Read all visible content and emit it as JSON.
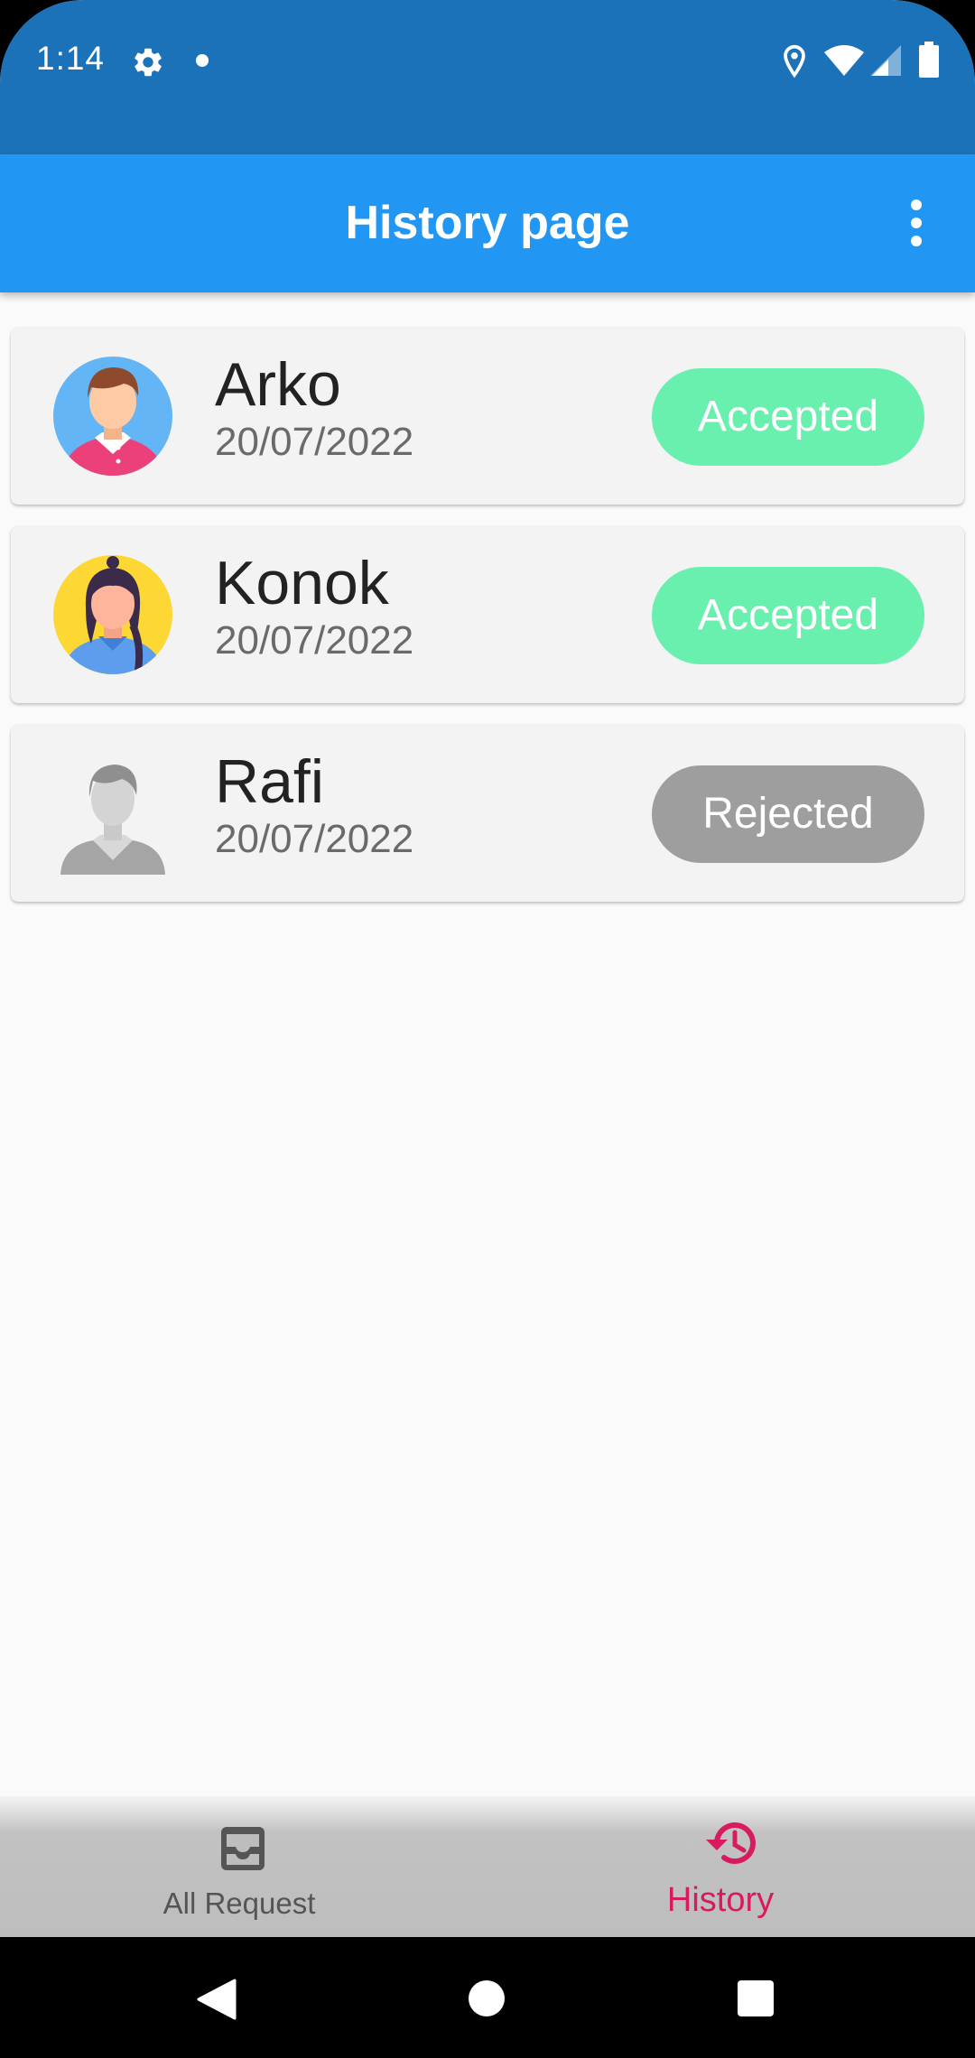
{
  "status_bar": {
    "time": "1:14",
    "icons": [
      "gear-icon",
      "dot-icon",
      "location-icon",
      "wifi-icon",
      "signal-icon",
      "battery-icon"
    ]
  },
  "app_bar": {
    "title": "History page",
    "menu_icon": "more-vert-icon"
  },
  "history": [
    {
      "name": "Arko",
      "date": "20/07/2022",
      "status": "Accepted",
      "status_color": "#69f0ae",
      "avatar": "boy-avatar"
    },
    {
      "name": "Konok",
      "date": "20/07/2022",
      "status": "Accepted",
      "status_color": "#69f0ae",
      "avatar": "girl-avatar"
    },
    {
      "name": "Rafi",
      "date": "20/07/2022",
      "status": "Rejected",
      "status_color": "#9e9e9e",
      "avatar": "default-avatar"
    }
  ],
  "bottom_nav": {
    "items": [
      {
        "label": "All Request",
        "icon": "inbox-icon",
        "active": false
      },
      {
        "label": "History",
        "icon": "history-icon",
        "active": true
      }
    ],
    "active_color": "#d81b60"
  },
  "colors": {
    "status_bar": "#1b72b9",
    "app_bar": "#2196f3",
    "accepted": "#69f0ae",
    "rejected": "#9e9e9e"
  }
}
